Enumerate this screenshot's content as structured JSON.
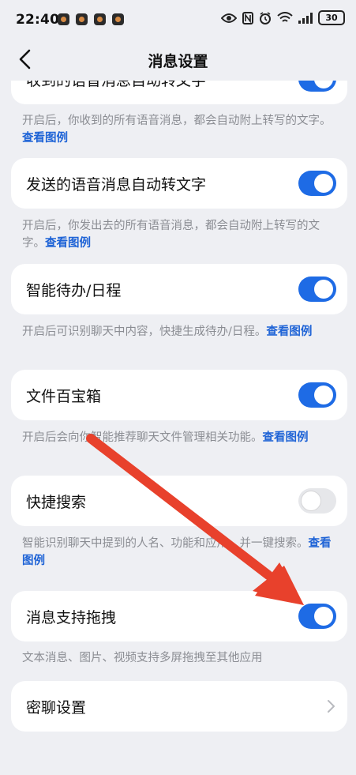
{
  "status_bar": {
    "time": "22:40",
    "battery": "30",
    "icons": [
      "app-icon",
      "app-icon",
      "app-icon",
      "app-icon",
      "eye-icon",
      "nfc-icon",
      "alarm-icon",
      "wifi-icon",
      "signal-icon",
      "battery-icon"
    ]
  },
  "nav": {
    "title": "消息设置",
    "back_icon": "back-chevron-icon"
  },
  "items": [
    {
      "label": "收到的语音消息自动转文字",
      "toggle": "on",
      "desc": "开启后，你收到的所有语音消息，都会自动附上转写的文字。",
      "link": "查看图例"
    },
    {
      "label": "发送的语音消息自动转文字",
      "toggle": "on",
      "desc": "开启后，你发出去的所有语音消息，都会自动附上转写的文字。",
      "link": "查看图例"
    },
    {
      "label": "智能待办/日程",
      "toggle": "on",
      "desc": "开启后可识别聊天中内容，快捷生成待办/日程。",
      "link": "查看图例"
    },
    {
      "label": "文件百宝箱",
      "toggle": "on",
      "desc": "开启后会向你智能推荐聊天文件管理相关功能。",
      "link": "查看图例"
    },
    {
      "label": "快捷搜索",
      "toggle": "off",
      "desc": "智能识别聊天中提到的人名、功能和应用，并一键搜索。",
      "link": "查看图例"
    },
    {
      "label": "消息支持拖拽",
      "toggle": "on",
      "desc": "文本消息、图片、视频支持多屏拖拽至其他应用"
    },
    {
      "label": "密聊设置"
    }
  ],
  "colors": {
    "accent": "#1e6be5",
    "annotation_arrow": "#e8412c",
    "background": "#eeeff3"
  }
}
